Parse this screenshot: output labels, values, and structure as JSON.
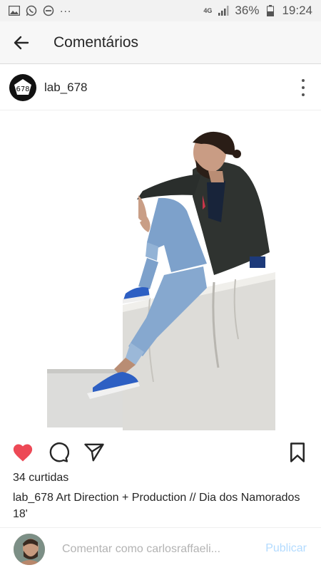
{
  "status_bar": {
    "network": "4G",
    "battery_percent": "36%",
    "time": "19:24",
    "dots": "...",
    "icons": [
      "gallery-icon",
      "whatsapp-icon",
      "do-not-disturb-icon",
      "signal-icon",
      "battery-icon"
    ]
  },
  "header": {
    "title": "Comentários"
  },
  "post": {
    "username": "lab_678",
    "avatar_logo_text": "678",
    "likes": "34 curtidas",
    "caption_user": "lab_678",
    "caption_text": "Art Direction + Production // Dia dos Namorados 18'",
    "liked": true,
    "like_color": "#ed4956"
  },
  "comment_box": {
    "placeholder": "Comentar como carlosraffaeli...",
    "publish_label": "Publicar",
    "publish_color": "#b3dbff"
  }
}
